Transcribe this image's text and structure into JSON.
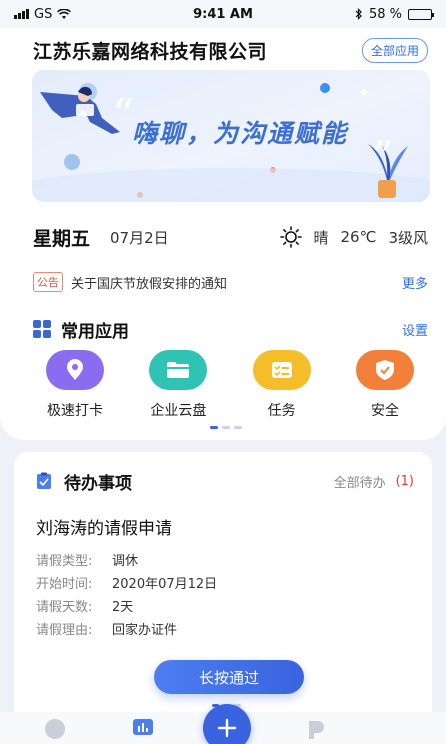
{
  "status_bar": {
    "carrier": "GS",
    "time": "9:41 AM",
    "battery": "58 %",
    "battery_level": 0.58
  },
  "header": {
    "company": "江苏乐嘉网络科技有限公司",
    "all_apps_label": "全部应用"
  },
  "banner": {
    "slogan": "嗨聊，为沟通赋能",
    "quote_open": "“",
    "quote_close": "”"
  },
  "date_info": {
    "weekday": "星期五",
    "date": "07月2日",
    "weather": "晴",
    "temperature": "26℃",
    "wind": "3级风",
    "weather_icon": "sun-icon"
  },
  "notice": {
    "tag": "公告",
    "text": "关于国庆节放假安排的通知",
    "more_label": "更多"
  },
  "common_apps": {
    "title": "常用应用",
    "settings_label": "设置",
    "items": [
      {
        "label": "极速打卡",
        "icon": "location-pin-icon",
        "color": "#8a6cf0"
      },
      {
        "label": "企业云盘",
        "icon": "folder-icon",
        "color": "#2fc3b4"
      },
      {
        "label": "任务",
        "icon": "task-list-icon",
        "color": "#f5bd2a"
      },
      {
        "label": "安全",
        "icon": "shield-icon",
        "color": "#f2803a"
      }
    ]
  },
  "todo": {
    "title": "待办事项",
    "all_label": "全部待办",
    "count": "(1)",
    "item_title": "刘海涛的请假申请",
    "fields": [
      {
        "label": "请假类型:",
        "value": "调休"
      },
      {
        "label": "开始时间:",
        "value": "2020年07月12日"
      },
      {
        "label": "请假天数:",
        "value": "2天"
      },
      {
        "label": "请假理由:",
        "value": "回家办证件"
      }
    ],
    "approve_label": "长按通过"
  },
  "tab_bar": {
    "items": [
      "chat-icon",
      "dashboard-icon",
      "add-icon",
      "profile-icon"
    ]
  },
  "colors": {
    "accent": "#3a63df",
    "link": "#2f6fe0",
    "alert": "#d9413a"
  }
}
